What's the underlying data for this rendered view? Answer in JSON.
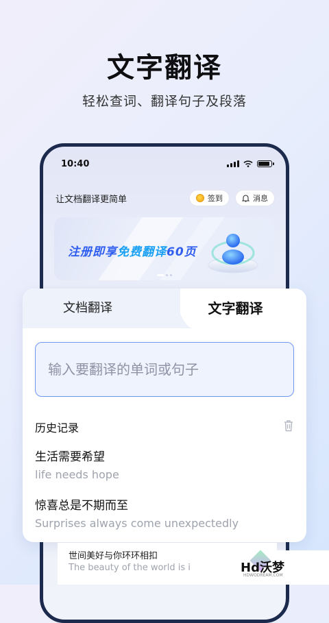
{
  "hero": {
    "title": "文字翻译",
    "subtitle": "轻松查词、翻译句子及段落"
  },
  "status_bar": {
    "time": "10:40"
  },
  "app": {
    "title": "让文档翻译更简单",
    "checkin_label": "签到",
    "messages_label": "消息"
  },
  "banner": {
    "text_prefix": "注册即享",
    "text_highlight": "免费翻译",
    "text_suffix": "60页"
  },
  "tabs": [
    {
      "label": "文档翻译",
      "active": false
    },
    {
      "label": "文字翻译",
      "active": true
    }
  ],
  "input": {
    "placeholder": "输入要翻译的单词或句子",
    "value": ""
  },
  "history": {
    "heading": "历史记录",
    "items": [
      {
        "source": "生活需要希望",
        "translation": "life needs hope"
      },
      {
        "source": "惊喜总是不期而至",
        "translation": "Surprises always come unexpectedly"
      },
      {
        "source": "世间美好与你环环相扣",
        "translation": "The beauty of the world is i"
      }
    ]
  },
  "watermark": {
    "text": "Hd沃梦",
    "sub": "HDWODREAM.COM"
  },
  "colors": {
    "accent": "#2f5df0",
    "input_border": "#6f95f3",
    "phone_frame": "#1b2a4d"
  }
}
